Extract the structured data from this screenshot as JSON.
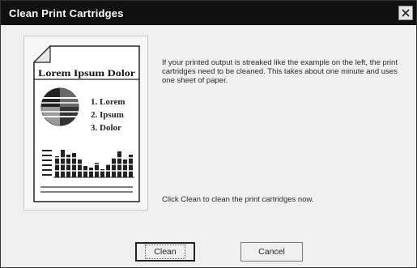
{
  "dialog": {
    "title": "Clean Print Cartridges",
    "message": "If your printed output is streaked like the example on the left, the print cartridges need to be cleaned.  This takes about one minute and uses one sheet of paper.",
    "prompt": "Click Clean to clean the print cartridges now.",
    "buttons": {
      "clean": "Clean",
      "cancel": "Cancel"
    }
  },
  "sample_page": {
    "heading": "Lorem Ipsum Dolor",
    "list": [
      "1. Lorem",
      "2. Ipsum",
      "3. Dolor"
    ]
  },
  "icons": {
    "close": "close-icon"
  }
}
